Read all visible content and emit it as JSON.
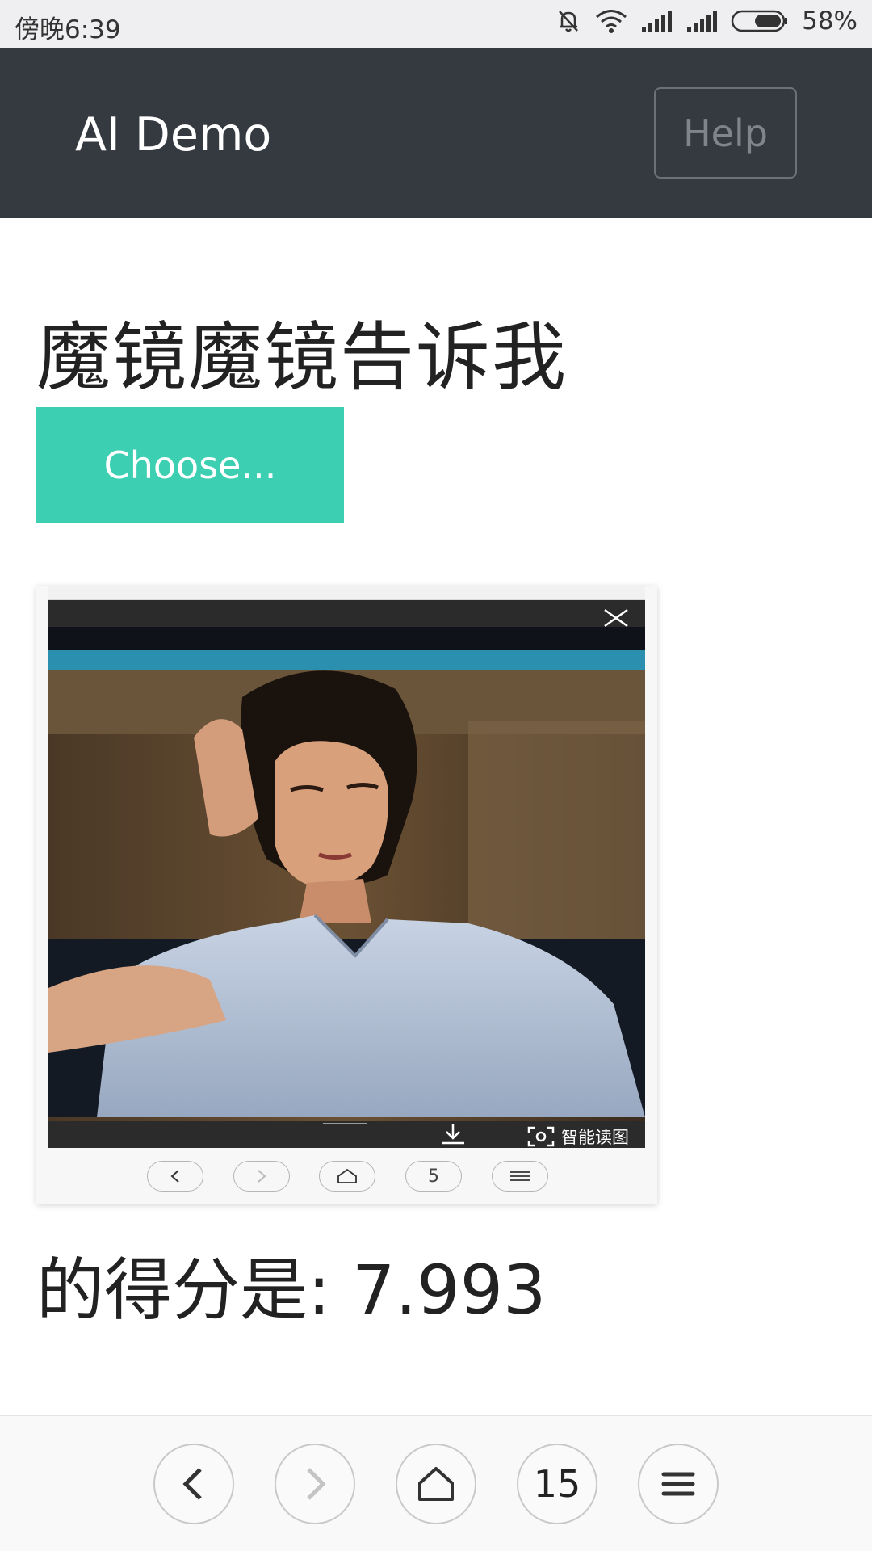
{
  "status_bar": {
    "time": "傍晚6:39",
    "battery_percent": "58%",
    "icons": [
      "mute-bell-icon",
      "wifi-icon",
      "signal-icon",
      "signal-icon",
      "battery-icon"
    ]
  },
  "navbar": {
    "brand": "AI Demo",
    "help_label": "Help",
    "background": "#343a40"
  },
  "main": {
    "title": "魔镜魔镜告诉我",
    "choose_label": "Choose...",
    "choose_color": "#3ccfb1",
    "preview": {
      "smart_read_label": "智能读图",
      "tab_count": "5"
    },
    "score_text": "的得分是: 7.993"
  },
  "browser_bar": {
    "tab_count": "15"
  }
}
